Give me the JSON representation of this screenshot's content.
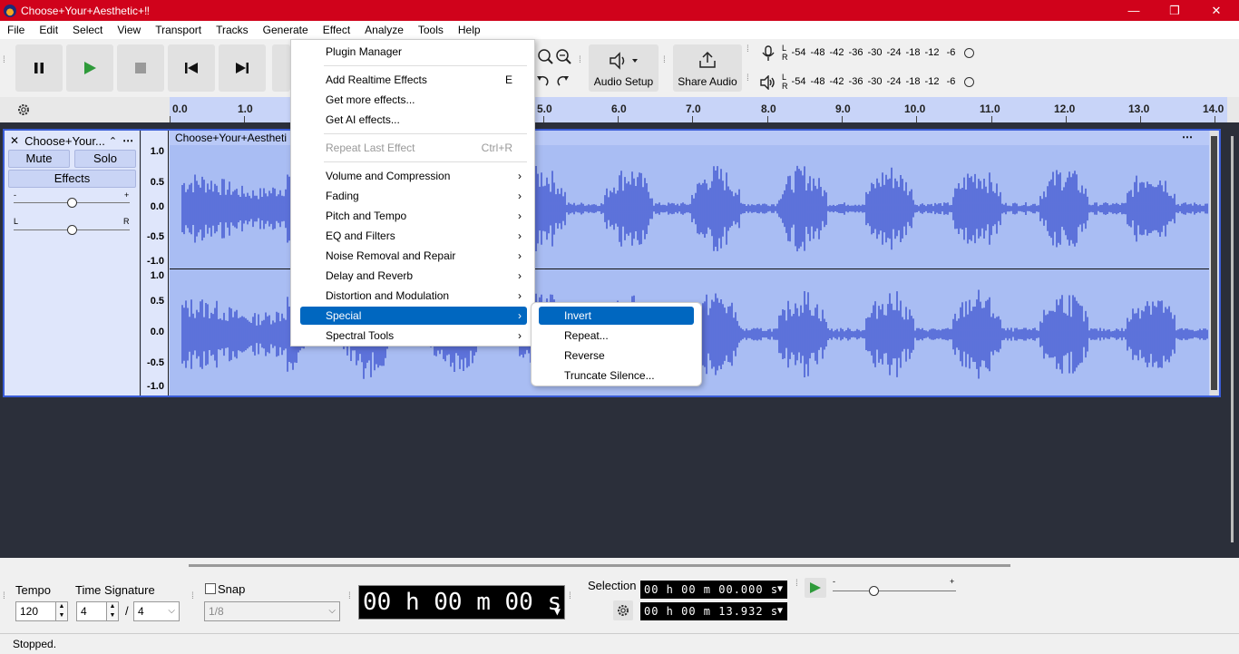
{
  "window": {
    "title": "Choose+Your+Aesthetic+‼",
    "minimize_glyph": "—",
    "maximize_glyph": "❐",
    "close_glyph": "✕"
  },
  "menubar": [
    "File",
    "Edit",
    "Select",
    "View",
    "Transport",
    "Tracks",
    "Generate",
    "Effect",
    "Analyze",
    "Tools",
    "Help"
  ],
  "toolbar": {
    "audio_setup": "Audio Setup",
    "share_audio": "Share Audio",
    "meter_scale": [
      "-54",
      "-48",
      "-42",
      "-36",
      "-30",
      "-24",
      "-18",
      "-12",
      "-6"
    ],
    "meter_l": "L",
    "meter_r": "R"
  },
  "ruler": {
    "ticks": [
      "0.0",
      "1.0",
      "5.0",
      "6.0",
      "7.0",
      "8.0",
      "9.0",
      "10.0",
      "11.0",
      "12.0",
      "13.0",
      "14.0"
    ]
  },
  "track": {
    "name": "Choose+Your...",
    "clip_name": "Choose+Your+Aestheti",
    "mute": "Mute",
    "solo": "Solo",
    "effects": "Effects",
    "gain_minus": "-",
    "gain_plus": "+",
    "pan_l": "L",
    "pan_r": "R",
    "scale_top": [
      "1.0",
      "0.5",
      "0.0",
      "-0.5",
      "-1.0"
    ],
    "scale_bottom": [
      "1.0",
      "0.5",
      "0.0",
      "-0.5",
      "-1.0"
    ]
  },
  "effect_menu": {
    "items": [
      {
        "label": "Plugin Manager"
      },
      {
        "label": "Add Realtime Effects",
        "shortcut": "E"
      },
      {
        "label": "Get more effects..."
      },
      {
        "label": "Get AI effects..."
      },
      {
        "label": "Repeat Last Effect",
        "shortcut": "Ctrl+R"
      },
      {
        "label": "Volume and Compression"
      },
      {
        "label": "Fading"
      },
      {
        "label": "Pitch and Tempo"
      },
      {
        "label": "EQ and Filters"
      },
      {
        "label": "Noise Removal and Repair"
      },
      {
        "label": "Delay and Reverb"
      },
      {
        "label": "Distortion and Modulation"
      },
      {
        "label": "Special"
      },
      {
        "label": "Spectral Tools"
      }
    ],
    "submenu_arrow": "›"
  },
  "special_submenu": {
    "items": [
      "Invert",
      "Repeat...",
      "Reverse",
      "Truncate Silence..."
    ]
  },
  "bottom": {
    "tempo_label": "Tempo",
    "tempo_value": "120",
    "time_signature_label": "Time Signature",
    "ts_numerator": "4",
    "ts_slash": "/",
    "ts_denominator": "4",
    "snap_label": "Snap",
    "snap_value": "1/8",
    "time_display": "00 h 00 m 00 s",
    "selection_label": "Selection",
    "selection_start": "00 h 00 m 00.000 s",
    "selection_end": "00 h 00 m 13.932 s",
    "speed_minus": "-",
    "speed_plus": "+"
  },
  "status": {
    "text": "Stopped."
  }
}
